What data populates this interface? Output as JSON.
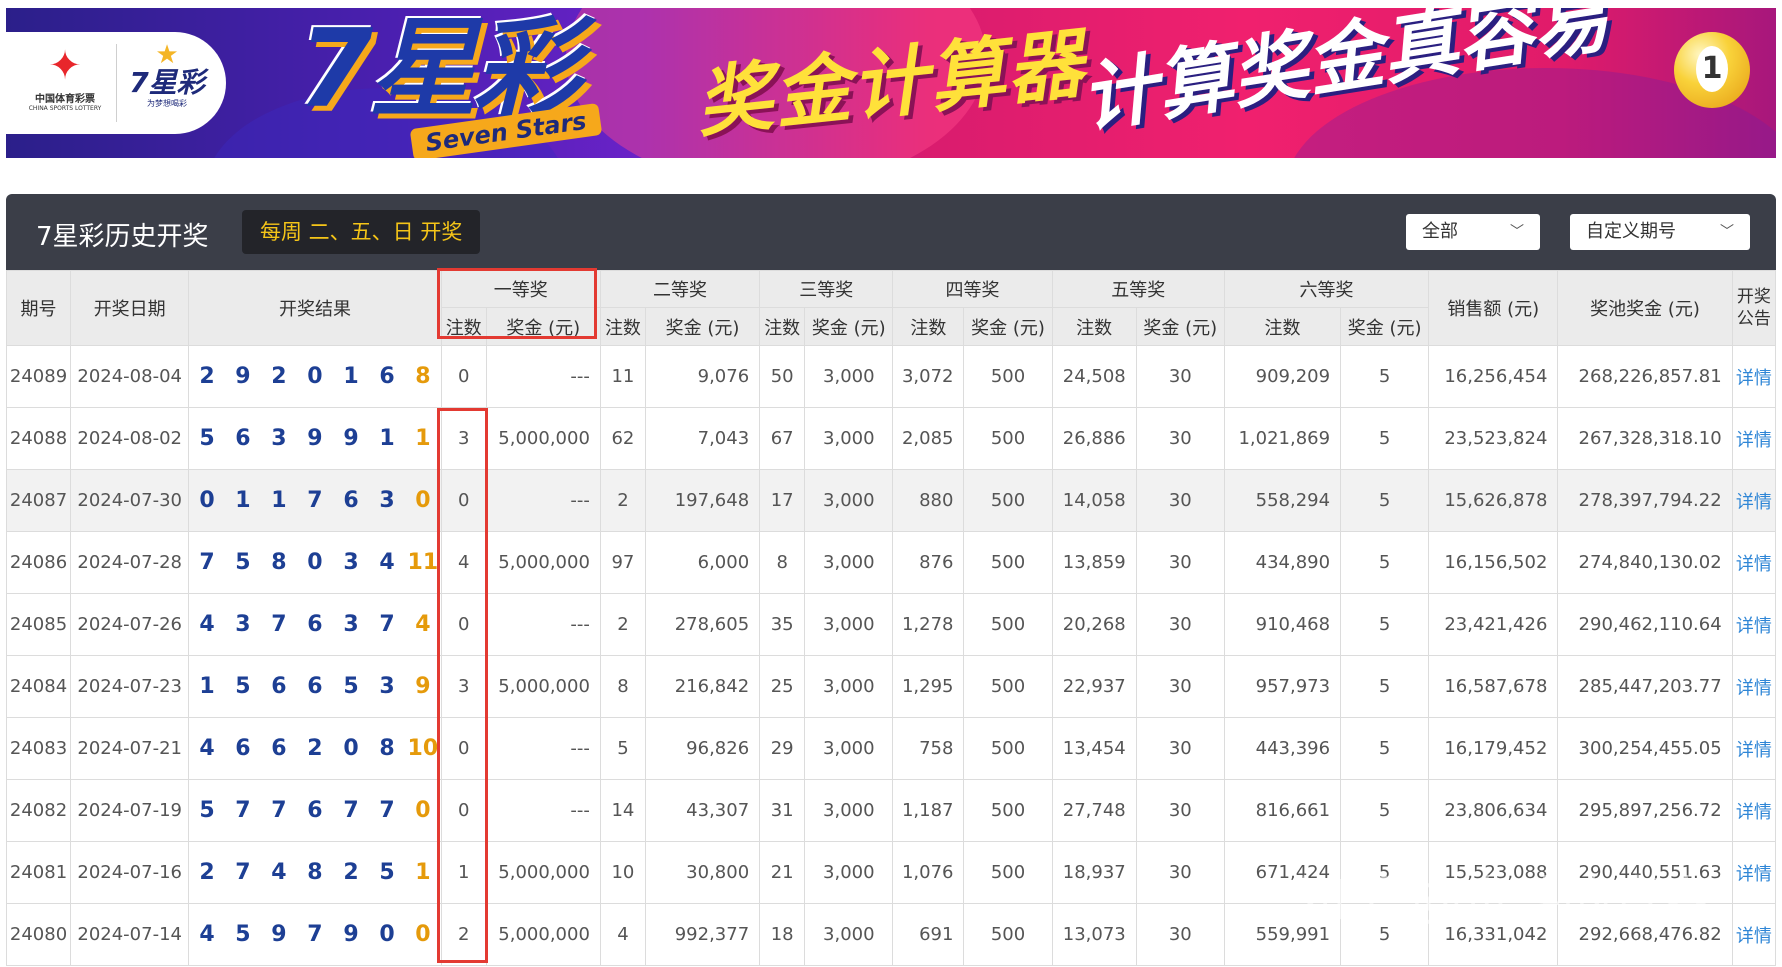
{
  "banner": {
    "org_name": "中国体育彩票",
    "org_sub": "CHINA SPORTS LOTTERY",
    "mini_logo": "7星彩",
    "mini_tag": "为梦想喝彩",
    "brand": "7星彩",
    "brand_en": "Seven Stars",
    "slogan_1": "奖金计算器",
    "slogan_2": "计算奖金真容易",
    "ball_number": "1"
  },
  "header": {
    "title": "7星彩历史开奖",
    "schedule": "每周 二、五、日 开奖",
    "filter_all": "全部",
    "filter_period": "自定义期号"
  },
  "columns": {
    "period": "期号",
    "date": "开奖日期",
    "result": "开奖结果",
    "prize1": "一等奖",
    "prize2": "二等奖",
    "prize3": "三等奖",
    "prize4": "四等奖",
    "prize5": "五等奖",
    "prize6": "六等奖",
    "count": "注数",
    "amount": "奖金 (元)",
    "sales": "销售额 (元)",
    "pool": "奖池奖金 (元)",
    "notice": "开奖公告"
  },
  "rows": [
    {
      "period": "24089",
      "date": "2024-08-04",
      "balls": [
        "2",
        "9",
        "2",
        "0",
        "1",
        "6",
        "8"
      ],
      "p1n": "0",
      "p1a": "---",
      "p2n": "11",
      "p2a": "9,076",
      "p3n": "50",
      "p3a": "3,000",
      "p4n": "3,072",
      "p4a": "500",
      "p5n": "24,508",
      "p5a": "30",
      "p6n": "909,209",
      "p6a": "5",
      "sales": "16,256,454",
      "pool": "268,226,857.81",
      "link": "详情"
    },
    {
      "period": "24088",
      "date": "2024-08-02",
      "balls": [
        "5",
        "6",
        "3",
        "9",
        "9",
        "1",
        "1"
      ],
      "p1n": "3",
      "p1a": "5,000,000",
      "p2n": "62",
      "p2a": "7,043",
      "p3n": "67",
      "p3a": "3,000",
      "p4n": "2,085",
      "p4a": "500",
      "p5n": "26,886",
      "p5a": "30",
      "p6n": "1,021,869",
      "p6a": "5",
      "sales": "23,523,824",
      "pool": "267,328,318.10",
      "link": "详情"
    },
    {
      "period": "24087",
      "date": "2024-07-30",
      "balls": [
        "0",
        "1",
        "1",
        "7",
        "6",
        "3",
        "0"
      ],
      "p1n": "0",
      "p1a": "---",
      "p2n": "2",
      "p2a": "197,648",
      "p3n": "17",
      "p3a": "3,000",
      "p4n": "880",
      "p4a": "500",
      "p5n": "14,058",
      "p5a": "30",
      "p6n": "558,294",
      "p6a": "5",
      "sales": "15,626,878",
      "pool": "278,397,794.22",
      "link": "详情"
    },
    {
      "period": "24086",
      "date": "2024-07-28",
      "balls": [
        "7",
        "5",
        "8",
        "0",
        "3",
        "4",
        "11"
      ],
      "p1n": "4",
      "p1a": "5,000,000",
      "p2n": "97",
      "p2a": "6,000",
      "p3n": "8",
      "p3a": "3,000",
      "p4n": "876",
      "p4a": "500",
      "p5n": "13,859",
      "p5a": "30",
      "p6n": "434,890",
      "p6a": "5",
      "sales": "16,156,502",
      "pool": "274,840,130.02",
      "link": "详情"
    },
    {
      "period": "24085",
      "date": "2024-07-26",
      "balls": [
        "4",
        "3",
        "7",
        "6",
        "3",
        "7",
        "4"
      ],
      "p1n": "0",
      "p1a": "---",
      "p2n": "2",
      "p2a": "278,605",
      "p3n": "35",
      "p3a": "3,000",
      "p4n": "1,278",
      "p4a": "500",
      "p5n": "20,268",
      "p5a": "30",
      "p6n": "910,468",
      "p6a": "5",
      "sales": "23,421,426",
      "pool": "290,462,110.64",
      "link": "详情"
    },
    {
      "period": "24084",
      "date": "2024-07-23",
      "balls": [
        "1",
        "5",
        "6",
        "6",
        "5",
        "3",
        "9"
      ],
      "p1n": "3",
      "p1a": "5,000,000",
      "p2n": "8",
      "p2a": "216,842",
      "p3n": "25",
      "p3a": "3,000",
      "p4n": "1,295",
      "p4a": "500",
      "p5n": "22,937",
      "p5a": "30",
      "p6n": "957,973",
      "p6a": "5",
      "sales": "16,587,678",
      "pool": "285,447,203.77",
      "link": "详情"
    },
    {
      "period": "24083",
      "date": "2024-07-21",
      "balls": [
        "4",
        "6",
        "6",
        "2",
        "0",
        "8",
        "10"
      ],
      "p1n": "0",
      "p1a": "---",
      "p2n": "5",
      "p2a": "96,826",
      "p3n": "29",
      "p3a": "3,000",
      "p4n": "758",
      "p4a": "500",
      "p5n": "13,454",
      "p5a": "30",
      "p6n": "443,396",
      "p6a": "5",
      "sales": "16,179,452",
      "pool": "300,254,455.05",
      "link": "详情"
    },
    {
      "period": "24082",
      "date": "2024-07-19",
      "balls": [
        "5",
        "7",
        "7",
        "6",
        "7",
        "7",
        "0"
      ],
      "p1n": "0",
      "p1a": "---",
      "p2n": "14",
      "p2a": "43,307",
      "p3n": "31",
      "p3a": "3,000",
      "p4n": "1,187",
      "p4a": "500",
      "p5n": "27,748",
      "p5a": "30",
      "p6n": "816,661",
      "p6a": "5",
      "sales": "23,806,634",
      "pool": "295,897,256.72",
      "link": "详情"
    },
    {
      "period": "24081",
      "date": "2024-07-16",
      "balls": [
        "2",
        "7",
        "4",
        "8",
        "2",
        "5",
        "1"
      ],
      "p1n": "1",
      "p1a": "5,000,000",
      "p2n": "10",
      "p2a": "30,800",
      "p3n": "21",
      "p3a": "3,000",
      "p4n": "1,076",
      "p4a": "500",
      "p5n": "18,937",
      "p5a": "30",
      "p6n": "671,424",
      "p6a": "5",
      "sales": "15,523,088",
      "pool": "290,440,551.63",
      "link": "详情"
    },
    {
      "period": "24080",
      "date": "2024-07-14",
      "balls": [
        "4",
        "5",
        "9",
        "7",
        "9",
        "0",
        "0"
      ],
      "p1n": "2",
      "p1a": "5,000,000",
      "p2n": "4",
      "p2a": "992,377",
      "p3n": "18",
      "p3a": "3,000",
      "p4n": "691",
      "p4a": "500",
      "p5n": "13,073",
      "p5a": "30",
      "p6n": "559,991",
      "p6a": "5",
      "sales": "16,331,042",
      "pool": "292,668,476.82",
      "link": "详情"
    }
  ],
  "watermark": "知乎 @奋斗的青春",
  "colors": {
    "ball_red": "#1d3f94",
    "ball_blue": "#e59a0b",
    "link": "#2f86d6",
    "highlight": "#e33a32",
    "header_bar": "#3b3e48",
    "schedule_text": "#f5c518"
  }
}
